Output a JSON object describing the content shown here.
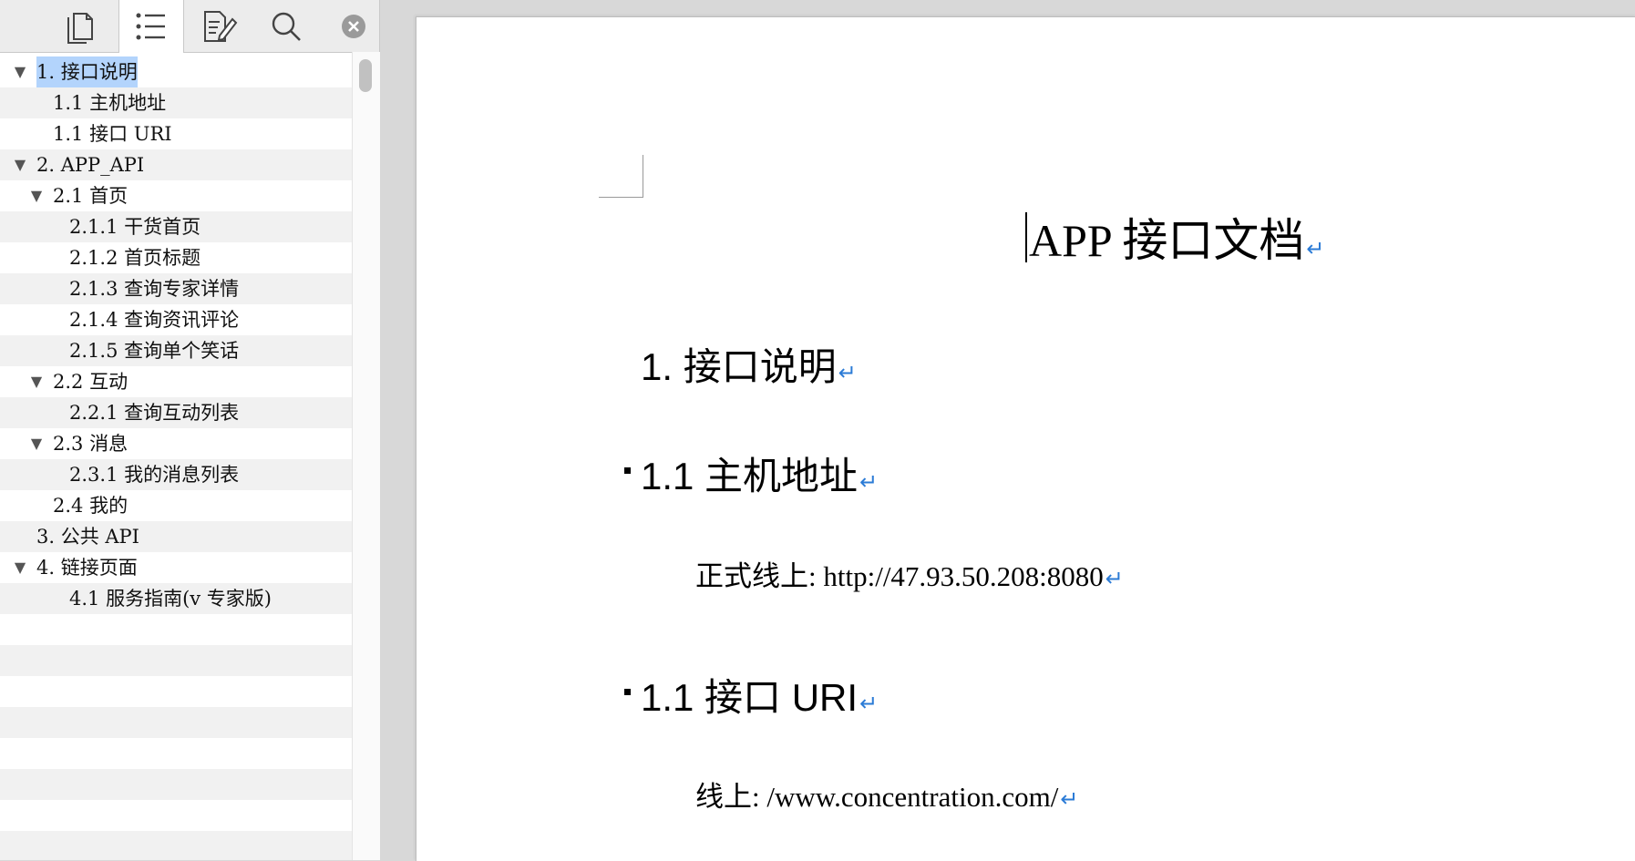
{
  "sidebar": {
    "tabs": [
      {
        "name": "pages-tab",
        "icon": "pages-icon"
      },
      {
        "name": "outline-tab",
        "icon": "list-icon"
      },
      {
        "name": "edit-tab",
        "icon": "document-edit-icon"
      },
      {
        "name": "search-tab",
        "icon": "search-icon"
      },
      {
        "name": "close-tab",
        "icon": "close-icon"
      }
    ],
    "outline": [
      {
        "label": "1. 接口说明",
        "level": 0,
        "expanded": true,
        "selected": true
      },
      {
        "label": "1.1 主机地址",
        "level": 1
      },
      {
        "label": "1.1 接口 URI",
        "level": 1
      },
      {
        "label": "2. APP_API",
        "level": 0,
        "expanded": true
      },
      {
        "label": "2.1 首页",
        "level": 1,
        "expanded": true
      },
      {
        "label": "2.1.1 干货首页",
        "level": 2
      },
      {
        "label": "2.1.2 首页标题",
        "level": 2
      },
      {
        "label": "2.1.3 查询专家详情",
        "level": 2
      },
      {
        "label": "2.1.4 查询资讯评论",
        "level": 2
      },
      {
        "label": "2.1.5 查询单个笑话",
        "level": 2
      },
      {
        "label": "2.2 互动",
        "level": 1,
        "expanded": true
      },
      {
        "label": "2.2.1 查询互动列表",
        "level": 2
      },
      {
        "label": "2.3 消息",
        "level": 1,
        "expanded": true
      },
      {
        "label": "2.3.1 我的消息列表",
        "level": 2
      },
      {
        "label": "2.4 我的",
        "level": 1
      },
      {
        "label": "3. 公共 API",
        "level": 0
      },
      {
        "label": "4. 链接页面",
        "level": 0,
        "expanded": true
      },
      {
        "label": "4.1 服务指南(v 专家版)",
        "level": 2
      }
    ]
  },
  "document": {
    "title": "APP 接口文档",
    "h1": "1. 接口说明",
    "section1": {
      "heading": "1.1 主机地址",
      "body": "正式线上: http://47.93.50.208:8080"
    },
    "section2": {
      "heading": "1.1 接口 URI",
      "body": "线上: /www.concentration.com/"
    },
    "paragraph_mark": "↵"
  },
  "colors": {
    "selection": "#b3d4fc",
    "paragraph_mark": "#2b7bd6",
    "stripe": "#f1f1f1"
  }
}
